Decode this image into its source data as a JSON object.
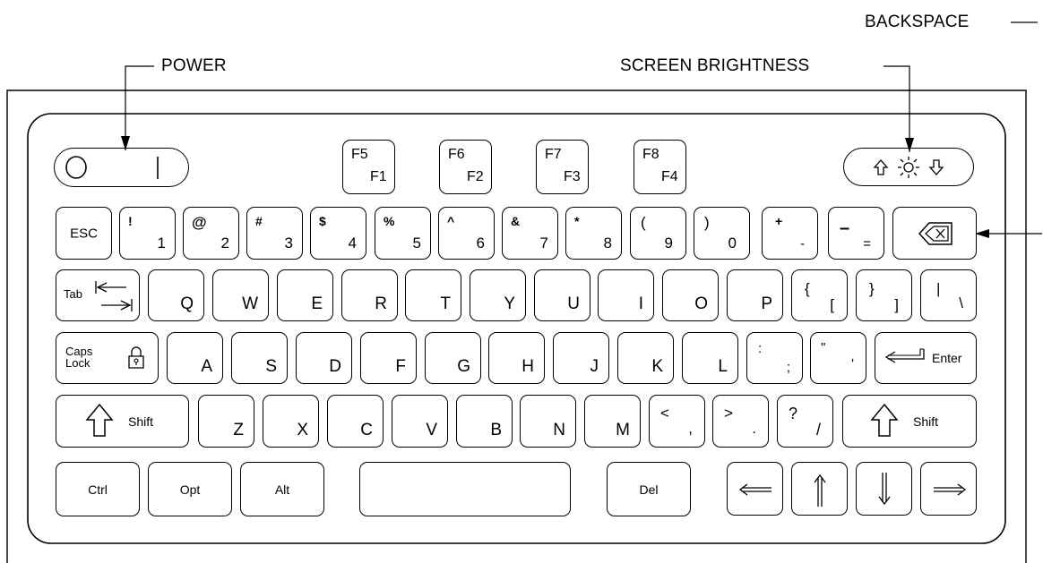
{
  "callouts": {
    "power": "POWER",
    "screen_brightness": "SCREEN BRIGHTNESS",
    "backspace": "BACKSPACE"
  },
  "fkeys": [
    {
      "top": "F5",
      "bottom": "F1"
    },
    {
      "top": "F6",
      "bottom": "F2"
    },
    {
      "top": "F7",
      "bottom": "F3"
    },
    {
      "top": "F8",
      "bottom": "F4"
    }
  ],
  "power": {
    "on": "O",
    "off": "|"
  },
  "number_row": {
    "esc": "ESC",
    "keys": [
      {
        "shift": "!",
        "base": "1"
      },
      {
        "shift": "@",
        "base": "2"
      },
      {
        "shift": "#",
        "base": "3"
      },
      {
        "shift": "$",
        "base": "4"
      },
      {
        "shift": "%",
        "base": "5"
      },
      {
        "shift": "^",
        "base": "6"
      },
      {
        "shift": "&",
        "base": "7"
      },
      {
        "shift": "*",
        "base": "8"
      },
      {
        "shift": "(",
        "base": "9"
      },
      {
        "shift": ")",
        "base": "0"
      },
      {
        "shift": "+",
        "base": "-"
      },
      {
        "shift": "–",
        "base": "="
      }
    ]
  },
  "top_row": {
    "tab": "Tab",
    "letters": [
      "Q",
      "W",
      "E",
      "R",
      "T",
      "Y",
      "U",
      "I",
      "O",
      "P"
    ],
    "symbols": [
      {
        "shift": "{",
        "base": "["
      },
      {
        "shift": "}",
        "base": "]"
      },
      {
        "shift": "|",
        "base": "\\"
      }
    ]
  },
  "home_row": {
    "caps": "Caps",
    "lock": "Lock",
    "letters": [
      "A",
      "S",
      "D",
      "F",
      "G",
      "H",
      "J",
      "K",
      "L"
    ],
    "symbols": [
      {
        "shift": ":",
        "base": ";"
      },
      {
        "shift": "\"",
        "base": "'"
      }
    ],
    "enter": "Enter"
  },
  "bottom_row": {
    "shift": "Shift",
    "letters": [
      "Z",
      "X",
      "C",
      "V",
      "B",
      "N",
      "M"
    ],
    "symbols": [
      {
        "shift": "<",
        "base": ","
      },
      {
        "shift": ">",
        "base": "."
      },
      {
        "shift": "?",
        "base": "/"
      }
    ]
  },
  "space_row": {
    "ctrl": "Ctrl",
    "opt": "Opt",
    "alt": "Alt",
    "del": "Del"
  }
}
